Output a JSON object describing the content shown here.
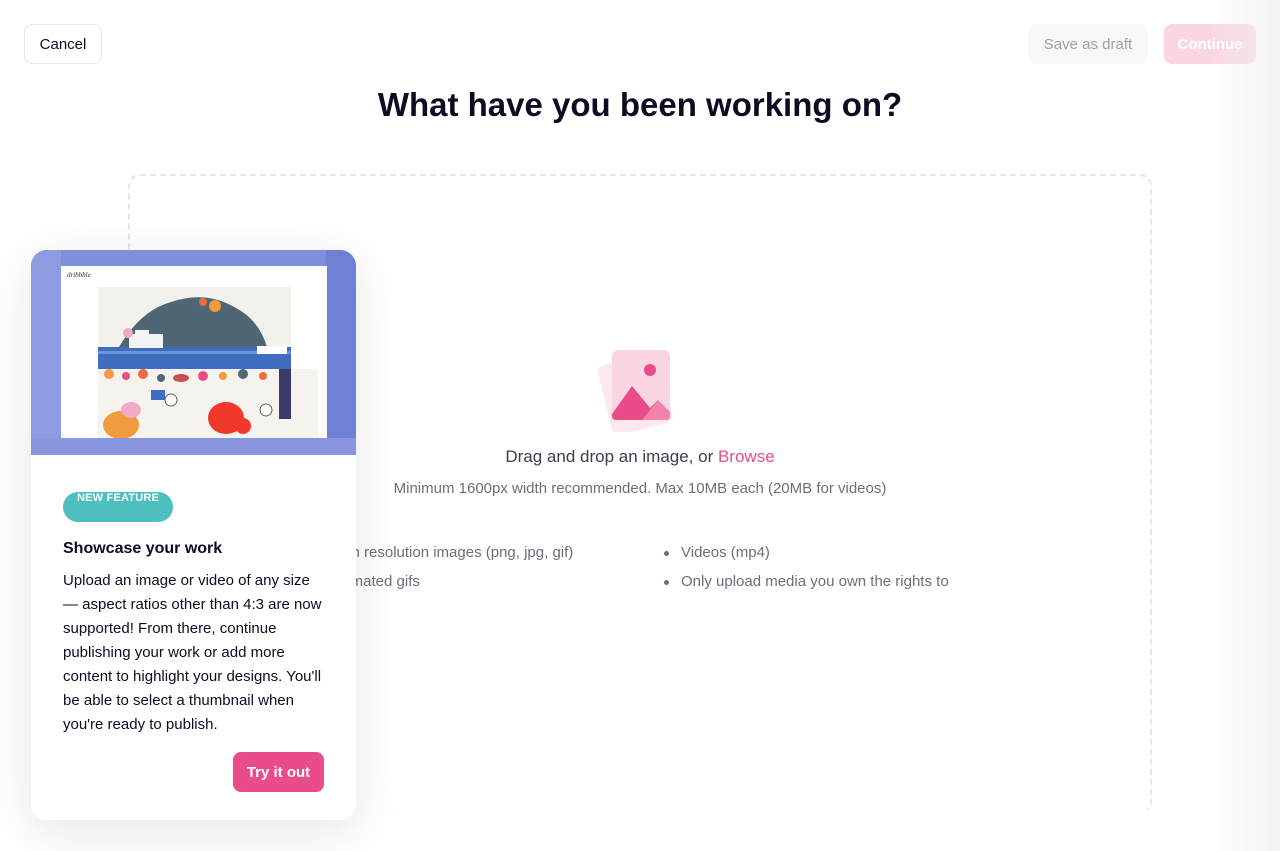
{
  "header": {
    "cancel_label": "Cancel",
    "save_draft_label": "Save as draft",
    "continue_label": "Continue"
  },
  "title": "What have you been working on?",
  "dropzone": {
    "prompt": "Drag and drop an image, or ",
    "browse_label": "Browse",
    "hint": "Minimum 1600px width recommended. Max 10MB each (20MB for videos)",
    "requirements_left": [
      "High resolution images (png, jpg, gif)",
      "Animated gifs"
    ],
    "requirements_right": [
      "Videos (mp4)",
      "Only upload media you own the rights to"
    ]
  },
  "feature_card": {
    "badge": "NEW FEATURE",
    "title": "Showcase your work",
    "description": "Upload an image or video of any size — aspect ratios other than 4:3 are now supported! From there, continue publishing your work or add more content to highlight your designs. You'll be able to select a thumbnail when you're ready to publish.",
    "button_label": "Try it out",
    "preview_logo": "dribbble"
  },
  "colors": {
    "accent": "#ea4c89",
    "accent_light": "#fad6e3",
    "badge_teal": "#4dbfbf",
    "hero_blue": "#7f8fdb",
    "text_dark": "#0d0c22"
  }
}
